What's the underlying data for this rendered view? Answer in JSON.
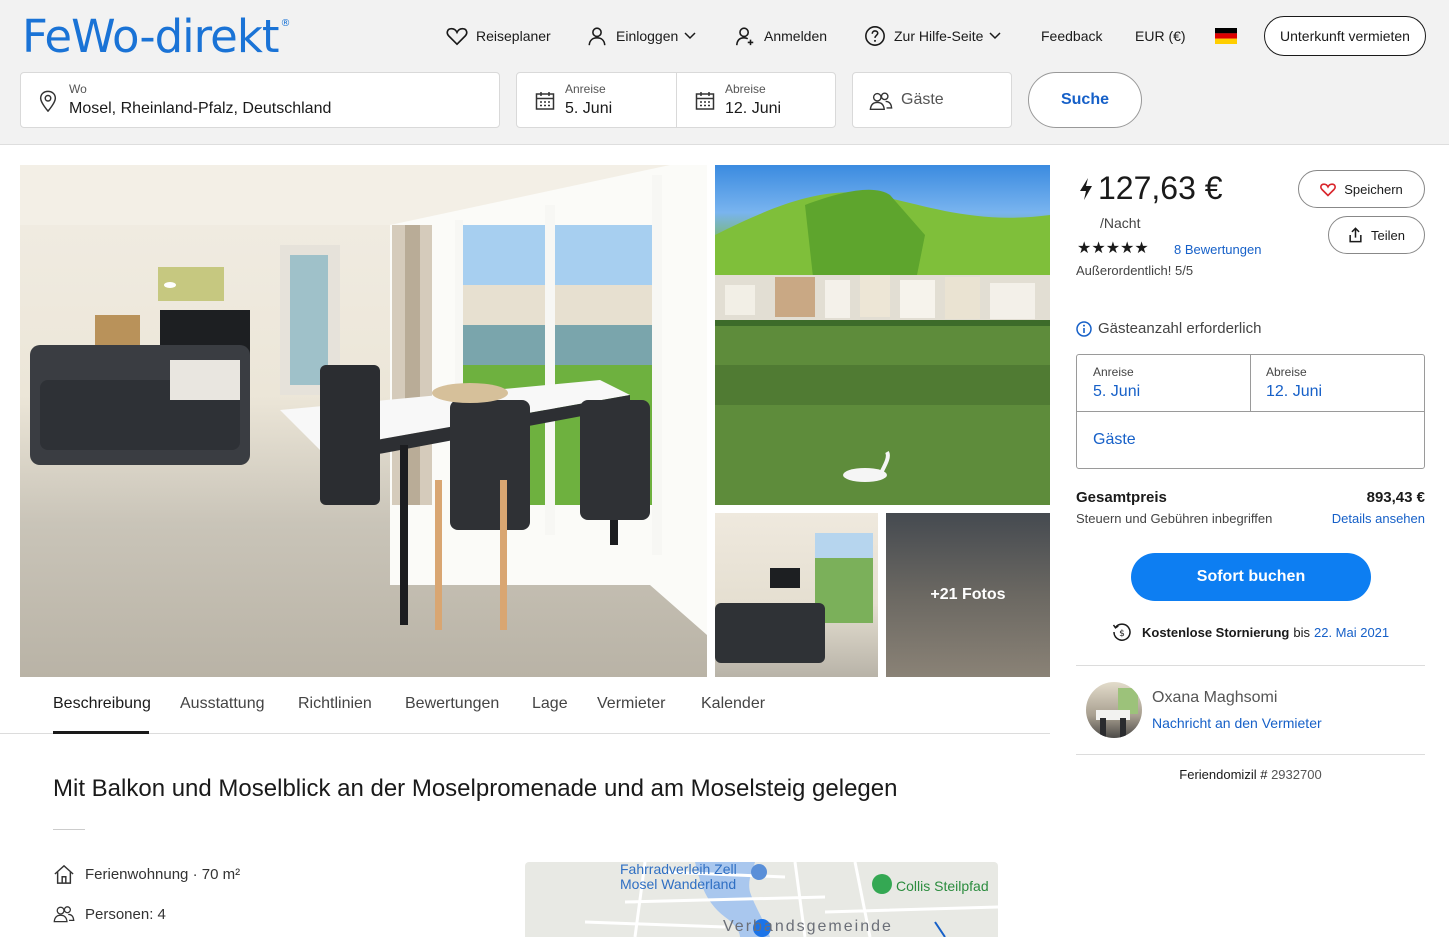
{
  "header": {
    "logo": "FeWo-direkt",
    "logo_mark": "®",
    "nav": {
      "reiseplaner": "Reiseplaner",
      "einloggen": "Einloggen",
      "anmelden": "Anmelden",
      "hilfe": "Zur Hilfe-Seite",
      "feedback": "Feedback",
      "currency": "EUR (€)"
    },
    "vermieten_label": "Unterkunft vermieten"
  },
  "search": {
    "wo_label": "Wo",
    "wo_value": "Mosel, Rheinland-Pfalz, Deutschland",
    "anreise_label": "Anreise",
    "anreise_value": "5. Juni",
    "abreise_label": "Abreise",
    "abreise_value": "12. Juni",
    "gaeste_placeholder": "Gäste",
    "suche_label": "Suche"
  },
  "gallery": {
    "more_photos": "+21 Fotos"
  },
  "tabs": [
    "Beschreibung",
    "Ausstattung",
    "Richtlinien",
    "Bewertungen",
    "Lage",
    "Vermieter",
    "Kalender"
  ],
  "listing": {
    "headline": "Mit Balkon und Moselblick an der Moselpromenade und am Moselsteig gelegen",
    "type": "Ferienwohnung · 70 m²",
    "persons": "Personen: 4"
  },
  "map": {
    "poi1": "Fahrradverleih Zell\nMosel Wanderland",
    "poi1_line1": "Fahrradverleih Zell",
    "poi1_line2": "Mosel Wanderland",
    "poi2": "Collis Steilpfad",
    "area": "Verbandsgemeinde"
  },
  "booking": {
    "price": "127,63 €",
    "per_night": "/Nacht",
    "stars": "★★★★★",
    "rating_value": 5,
    "reviews_link": "8 Bewertungen",
    "rating_text": "Außerordentlich! 5/5",
    "save_label": "Speichern",
    "share_label": "Teilen",
    "guests_required": "Gästeanzahl erforderlich",
    "anreise_label": "Anreise",
    "anreise_value": "5. Juni",
    "abreise_label": "Abreise",
    "abreise_value": "12. Juni",
    "gaeste_label": "Gäste",
    "total_label": "Gesamtpreis",
    "total_sub": "Steuern und Gebühren inbegriffen",
    "total_value": "893,43 €",
    "details_link": "Details ansehen",
    "book_label": "Sofort buchen",
    "cancel_bold": "Kostenlose Stornierung",
    "cancel_plain": "bis",
    "cancel_date": "22. Mai 2021"
  },
  "host": {
    "name": "Oxana Maghsomi",
    "message_link": "Nachricht an den Vermieter"
  },
  "feriendomizil": {
    "label": "Feriendomizil #",
    "number": "2932700"
  },
  "colors": {
    "brand_blue": "#1a73d6",
    "link_blue": "#1660c8",
    "book_button": "#0d7ef2",
    "heart_red": "#d9262c"
  }
}
